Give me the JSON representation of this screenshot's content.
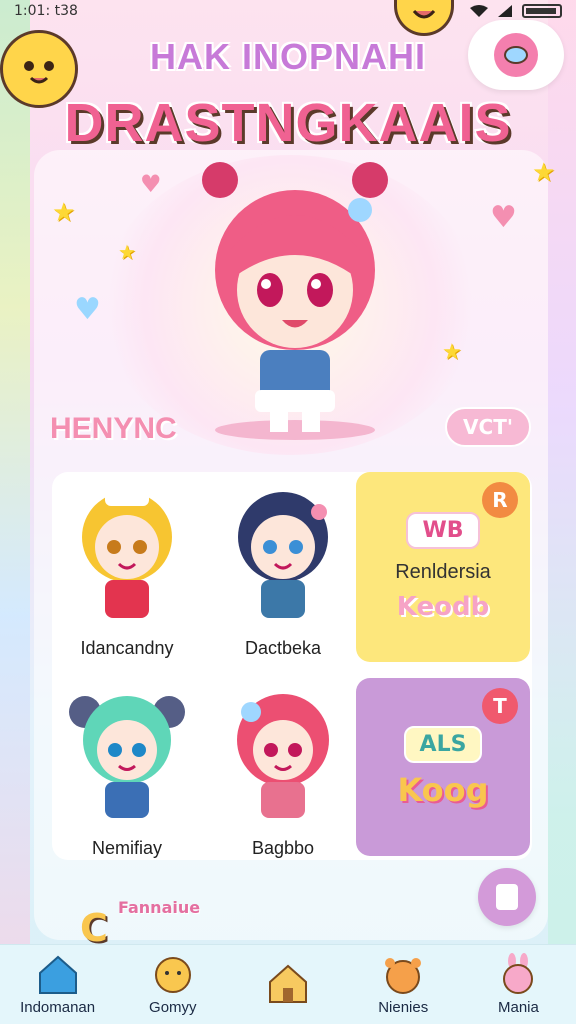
{
  "status": {
    "time": "1:01: t38"
  },
  "header": {
    "title_top": "HAK INOPNAHI",
    "title_main": "DRASTNGKAAIS"
  },
  "hero": {
    "badge_left": "HENYNC",
    "badge_right": "VCT'"
  },
  "characters": [
    {
      "name": "Idancandny"
    },
    {
      "name": "Dactbeka"
    },
    {
      "name": "Nemifiay"
    },
    {
      "name": "Bagbbo"
    }
  ],
  "tiles": [
    {
      "corner": "R",
      "pill": "WB",
      "text": "Renldersia",
      "bubble": "Keodb"
    },
    {
      "corner": "T",
      "pill": "ALS",
      "text": "",
      "bubble": "Koog"
    }
  ],
  "promo": {
    "letter": "C",
    "text": "Fannaiue"
  },
  "tabbar": {
    "items": [
      {
        "label": "Indomanan",
        "icon": "home-icon"
      },
      {
        "label": "Gomyy",
        "icon": "chick-icon"
      },
      {
        "label": "",
        "icon": "house-icon"
      },
      {
        "label": "Nienies",
        "icon": "bear-icon"
      },
      {
        "label": "Mania",
        "icon": "bunny-icon"
      }
    ]
  },
  "colors": {
    "accent_pink": "#f06292",
    "tile_yellow": "#fde77c",
    "tile_purple": "#c99ad8",
    "tabbar_bg": "#e4f6fb"
  }
}
